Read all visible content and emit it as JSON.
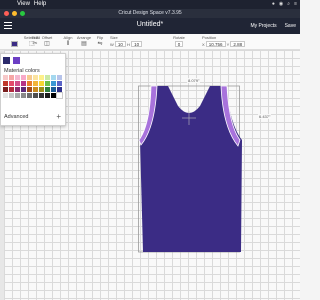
{
  "menubar": {
    "apple_glyph": "",
    "items": [
      "",
      "View",
      "Help"
    ],
    "tray_glyphs": [
      "●",
      "◉",
      "⌕",
      "≡"
    ]
  },
  "window": {
    "title": "Cricut Design Space  v7.3.95",
    "traffic_colors": [
      "#ff5f57",
      "#febc2e",
      "#28c840"
    ]
  },
  "header": {
    "doc_title": "Untitled*",
    "my_projects": "My Projects",
    "save": "Save"
  },
  "toolbar": {
    "color_value": "#3b2c85",
    "select_all": "Select All",
    "edit": "Edit",
    "offset": "Offset",
    "align": "Align",
    "arrange": "Arrange",
    "flip": "Flip",
    "size": "Size",
    "rotate": "Rotate",
    "position": "Position",
    "size_w_label": "W",
    "size_w_value": "10",
    "size_h_label": "H",
    "size_h_value": "10",
    "rotate_value": "0",
    "pos_x_label": "X",
    "pos_x_value": "10.756",
    "pos_y_label": "Y",
    "pos_y_value": "2.88"
  },
  "color_picker": {
    "selected_colors": [
      "#2b2a6b",
      "#6c3fc4"
    ],
    "label": "Material colors",
    "palette": [
      "#f7c9c9",
      "#f6a6a6",
      "#f4b7cf",
      "#f8a9c9",
      "#f6ca8f",
      "#fbe3a0",
      "#fdf08a",
      "#c9e9a5",
      "#a4d8ef",
      "#b6c3ea",
      "#c0392b",
      "#e34b6a",
      "#d24f8a",
      "#b53487",
      "#e87c2a",
      "#f2b53a",
      "#f6d634",
      "#6bbf49",
      "#3a97d4",
      "#5a63c7",
      "#7a1f1f",
      "#b22b3d",
      "#8c2a6d",
      "#5e2a79",
      "#a24a17",
      "#c98a1e",
      "#9b8e1a",
      "#2f7f3c",
      "#1e5d97",
      "#2e2f8a",
      "#e3e3e3",
      "#c7c7c7",
      "#a8a8a8",
      "#8a8a8a",
      "#6c6c6c",
      "#4f4f4f",
      "#333333",
      "#1b1b1b",
      "#000000",
      "#ffffff"
    ],
    "advanced_label": "Advanced",
    "plus_glyph": "+"
  },
  "design": {
    "fill_color": "#3b2c85",
    "trim_color": "#a873dc",
    "trim_edge": "#ffffff",
    "width_readout": "8.079\"",
    "height_readout": "6.437\""
  }
}
